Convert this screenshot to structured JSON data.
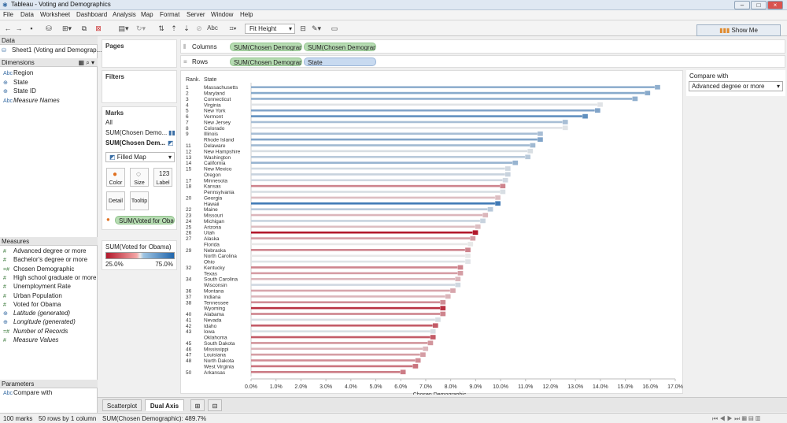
{
  "window": {
    "title": "Tableau - Voting and Demographics"
  },
  "menu": [
    "File",
    "Data",
    "Worksheet",
    "Dashboard",
    "Analysis",
    "Map",
    "Format",
    "Server",
    "Window",
    "Help"
  ],
  "toolbar": {
    "fit": "Fit Height",
    "abc": "Abc",
    "show_me": "Show Me"
  },
  "data_pane": {
    "title": "Data",
    "source": "Sheet1 (Voting and Demograp...",
    "dimensions_title": "Dimensions",
    "dimensions": [
      {
        "icon": "Abc",
        "label": "Region",
        "italic": false
      },
      {
        "icon": "globe-icon",
        "label": "State",
        "italic": false
      },
      {
        "icon": "globe-icon",
        "label": "State ID",
        "italic": false
      },
      {
        "icon": "Abc",
        "label": "Measure Names",
        "italic": true
      }
    ],
    "measures_title": "Measures",
    "measures": [
      {
        "icon": "#",
        "label": "Advanced degree or more",
        "italic": false
      },
      {
        "icon": "#",
        "label": "Bachelor's degree or more",
        "italic": false
      },
      {
        "icon": "=#",
        "label": "Chosen Demographic",
        "italic": false
      },
      {
        "icon": "#",
        "label": "High school graduate or more",
        "italic": false
      },
      {
        "icon": "#",
        "label": "Unemployment Rate",
        "italic": false
      },
      {
        "icon": "#",
        "label": "Urban Population",
        "italic": false
      },
      {
        "icon": "#",
        "label": "Voted for Obama",
        "italic": false
      },
      {
        "icon": "globe-icon",
        "label": "Latitude (generated)",
        "italic": true
      },
      {
        "icon": "globe-icon",
        "label": "Longitude (generated)",
        "italic": true
      },
      {
        "icon": "=#",
        "label": "Number of Records",
        "italic": true
      },
      {
        "icon": "#",
        "label": "Measure Values",
        "italic": true
      }
    ],
    "parameters_title": "Parameters",
    "parameters": [
      {
        "icon": "Abc",
        "label": "Compare with"
      }
    ]
  },
  "pages": {
    "title": "Pages"
  },
  "filters": {
    "title": "Filters"
  },
  "marks": {
    "title": "Marks",
    "all": "All",
    "layer1": "SUM(Chosen Demo...",
    "layer2": "SUM(Chosen Dem...",
    "mark_type": "Filled Map",
    "color": "Color",
    "size": "Size",
    "label": "Label",
    "detail": "Detail",
    "tooltip": "Tooltip",
    "color_pill": "SUM(Voted for Oba..."
  },
  "legend": {
    "title": "SUM(Voted for Obama)",
    "min": "25.0%",
    "max": "75.0%",
    "low_color": "#b2182b",
    "high_color": "#2166ac"
  },
  "shelves": {
    "columns_label": "Columns",
    "columns": [
      "SUM(Chosen Demograph...",
      "SUM(Chosen Demograph..."
    ],
    "rows_label": "Rows",
    "rows": [
      "SUM(Chosen Demograph...",
      "State"
    ]
  },
  "compare": {
    "title": "Compare with",
    "value": "Advanced degree or more"
  },
  "tabs": [
    "Scatterplot",
    "Dual Axis"
  ],
  "status": {
    "marks": "100 marks",
    "rows": "50 rows by 1 column",
    "sum": "SUM(Chosen Demographic): 489.7%"
  },
  "chart_data": {
    "type": "bar",
    "col_rank": "Rank.",
    "col_state": "State",
    "xlabel": "Chosen Demographic",
    "xlim": [
      0,
      17
    ],
    "xticks": [
      "0.0%",
      "1.0%",
      "2.0%",
      "3.0%",
      "4.0%",
      "5.0%",
      "6.0%",
      "7.0%",
      "8.0%",
      "9.0%",
      "10.0%",
      "11.0%",
      "12.0%",
      "13.0%",
      "14.0%",
      "15.0%",
      "16.0%",
      "17.0%"
    ],
    "ranks": [
      "1",
      "2",
      "3",
      "4",
      "5",
      "6",
      "7",
      "8",
      "9",
      "",
      "11",
      "12",
      "13",
      "14",
      "15",
      "",
      "17",
      "18",
      "",
      "20",
      "",
      "22",
      "23",
      "24",
      "25",
      "26",
      "27",
      "",
      "29",
      "",
      "",
      "32",
      "",
      "34",
      "",
      "36",
      "37",
      "38",
      "",
      "40",
      "41",
      "42",
      "43",
      "",
      "45",
      "46",
      "47",
      "48",
      "",
      "50"
    ],
    "states": [
      "Massachusetts",
      "Maryland",
      "Connecticut",
      "Virginia",
      "New York",
      "Vermont",
      "New Jersey",
      "Colorado",
      "Illinois",
      "Rhode Island",
      "Delaware",
      "New Hampshire",
      "Washington",
      "California",
      "New Mexico",
      "Oregon",
      "Minnesota",
      "Kansas",
      "Pennsylvania",
      "Georgia",
      "Hawaii",
      "Maine",
      "Missouri",
      "Michigan",
      "Arizona",
      "Utah",
      "Alaska",
      "Florida",
      "Nebraska",
      "North Carolina",
      "Ohio",
      "Kentucky",
      "Texas",
      "South Carolina",
      "Wisconsin",
      "Montana",
      "Indiana",
      "Tennessee",
      "Wyoming",
      "Alabama",
      "Nevada",
      "Idaho",
      "Iowa",
      "Oklahoma",
      "South Dakota",
      "Mississippi",
      "Louisiana",
      "North Dakota",
      "West Virginia",
      "Arkansas"
    ],
    "values": [
      16.4,
      16.0,
      15.5,
      14.1,
      14.0,
      13.5,
      12.7,
      12.7,
      11.7,
      11.7,
      11.4,
      11.3,
      11.2,
      10.7,
      10.4,
      10.4,
      10.3,
      10.2,
      10.2,
      10.0,
      10.0,
      9.7,
      9.5,
      9.4,
      9.2,
      9.1,
      9.0,
      8.9,
      8.8,
      8.8,
      8.8,
      8.5,
      8.5,
      8.4,
      8.4,
      8.2,
      8.0,
      7.8,
      7.8,
      7.8,
      7.6,
      7.5,
      7.4,
      7.4,
      7.3,
      7.1,
      7.0,
      6.8,
      6.7,
      6.2
    ],
    "obama_pct": [
      61,
      62,
      61,
      51,
      63,
      67,
      58,
      51,
      58,
      63,
      59,
      52,
      56,
      60,
      53,
      54,
      53,
      38,
      52,
      45,
      71,
      56,
      44,
      54,
      45,
      25,
      41,
      50,
      38,
      50,
      51,
      38,
      41,
      44,
      53,
      42,
      44,
      39,
      28,
      38,
      52,
      33,
      52,
      33,
      40,
      44,
      41,
      39,
      36,
      37
    ]
  }
}
